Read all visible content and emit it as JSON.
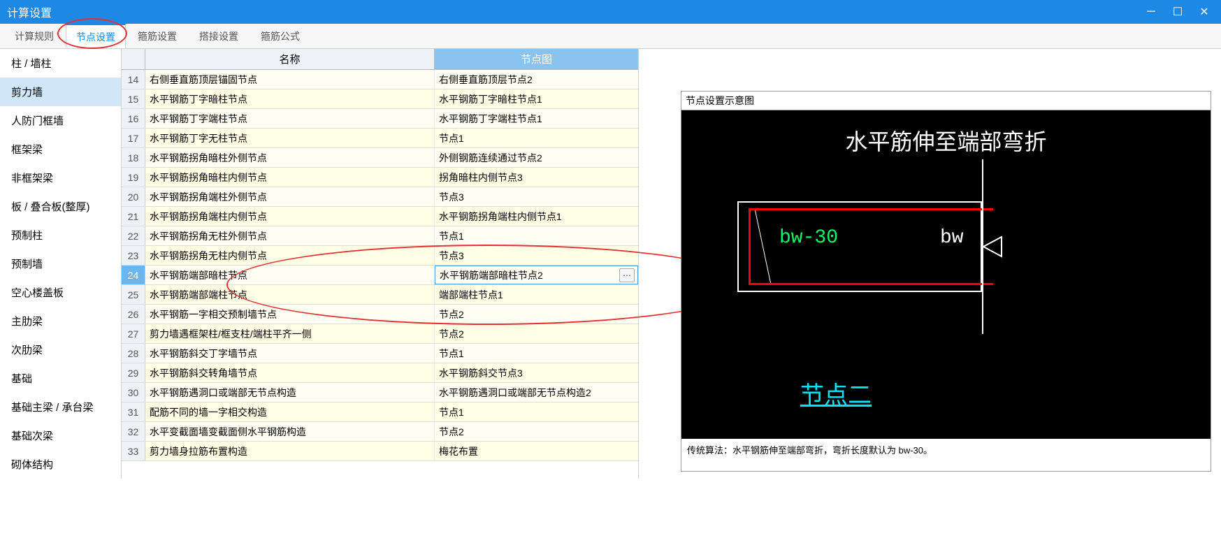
{
  "window": {
    "title": "计算设置"
  },
  "tabs": [
    "计算规则",
    "节点设置",
    "箍筋设置",
    "搭接设置",
    "箍筋公式"
  ],
  "activeTab": 1,
  "sidebar": {
    "items": [
      "柱 / 墙柱",
      "剪力墙",
      "人防门框墙",
      "框架梁",
      "非框架梁",
      "板 / 叠合板(整厚)",
      "预制柱",
      "预制墙",
      "空心楼盖板",
      "主肋梁",
      "次肋梁",
      "基础",
      "基础主梁 / 承台梁",
      "基础次梁",
      "砌体结构"
    ],
    "activeIndex": 1
  },
  "grid": {
    "headers": {
      "name": "名称",
      "node": "节点图"
    },
    "rows": [
      {
        "n": 14,
        "name": "右侧垂直筋顶层锚固节点",
        "node": "右侧垂直筋顶层节点2"
      },
      {
        "n": 15,
        "name": "水平钢筋丁字暗柱节点",
        "node": "水平钢筋丁字暗柱节点1"
      },
      {
        "n": 16,
        "name": "水平钢筋丁字端柱节点",
        "node": "水平钢筋丁字端柱节点1"
      },
      {
        "n": 17,
        "name": "水平钢筋丁字无柱节点",
        "node": "节点1"
      },
      {
        "n": 18,
        "name": "水平钢筋拐角暗柱外侧节点",
        "node": "外侧钢筋连续通过节点2"
      },
      {
        "n": 19,
        "name": "水平钢筋拐角暗柱内侧节点",
        "node": "拐角暗柱内侧节点3"
      },
      {
        "n": 20,
        "name": "水平钢筋拐角端柱外侧节点",
        "node": "节点3"
      },
      {
        "n": 21,
        "name": "水平钢筋拐角端柱内侧节点",
        "node": "水平钢筋拐角端柱内侧节点1"
      },
      {
        "n": 22,
        "name": "水平钢筋拐角无柱外侧节点",
        "node": "节点1"
      },
      {
        "n": 23,
        "name": "水平钢筋拐角无柱内侧节点",
        "node": "节点3"
      },
      {
        "n": 24,
        "name": "水平钢筋端部暗柱节点",
        "node": "水平钢筋端部暗柱节点2",
        "selected": true
      },
      {
        "n": 25,
        "name": "水平钢筋端部端柱节点",
        "node": "端部端柱节点1"
      },
      {
        "n": 26,
        "name": "水平钢筋一字相交预制墙节点",
        "node": "节点2"
      },
      {
        "n": 27,
        "name": "剪力墙遇框架柱/框支柱/端柱平齐一侧",
        "node": "节点2"
      },
      {
        "n": 28,
        "name": "水平钢筋斜交丁字墙节点",
        "node": "节点1"
      },
      {
        "n": 29,
        "name": "水平钢筋斜交转角墙节点",
        "node": "水平钢筋斜交节点3"
      },
      {
        "n": 30,
        "name": "水平钢筋遇洞口或端部无节点构造",
        "node": "水平钢筋遇洞口或端部无节点构造2"
      },
      {
        "n": 31,
        "name": "配筋不同的墙一字相交构造",
        "node": "节点1"
      },
      {
        "n": 32,
        "name": "水平变截面墙变截面侧水平钢筋构造",
        "node": "节点2"
      },
      {
        "n": 33,
        "name": "剪力墙身拉筋布置构造",
        "node": "梅花布置"
      }
    ]
  },
  "preview": {
    "title": "节点设置示意图",
    "diagramTitle": "水平筋伸至端部弯折",
    "label_bw30": "bw-30",
    "label_bw": "bw",
    "nodeLabel": "节点二",
    "footer": "传统算法：水平钢筋伸至端部弯折，弯折长度默认为 bw-30。"
  },
  "dotsLabel": "⋯"
}
